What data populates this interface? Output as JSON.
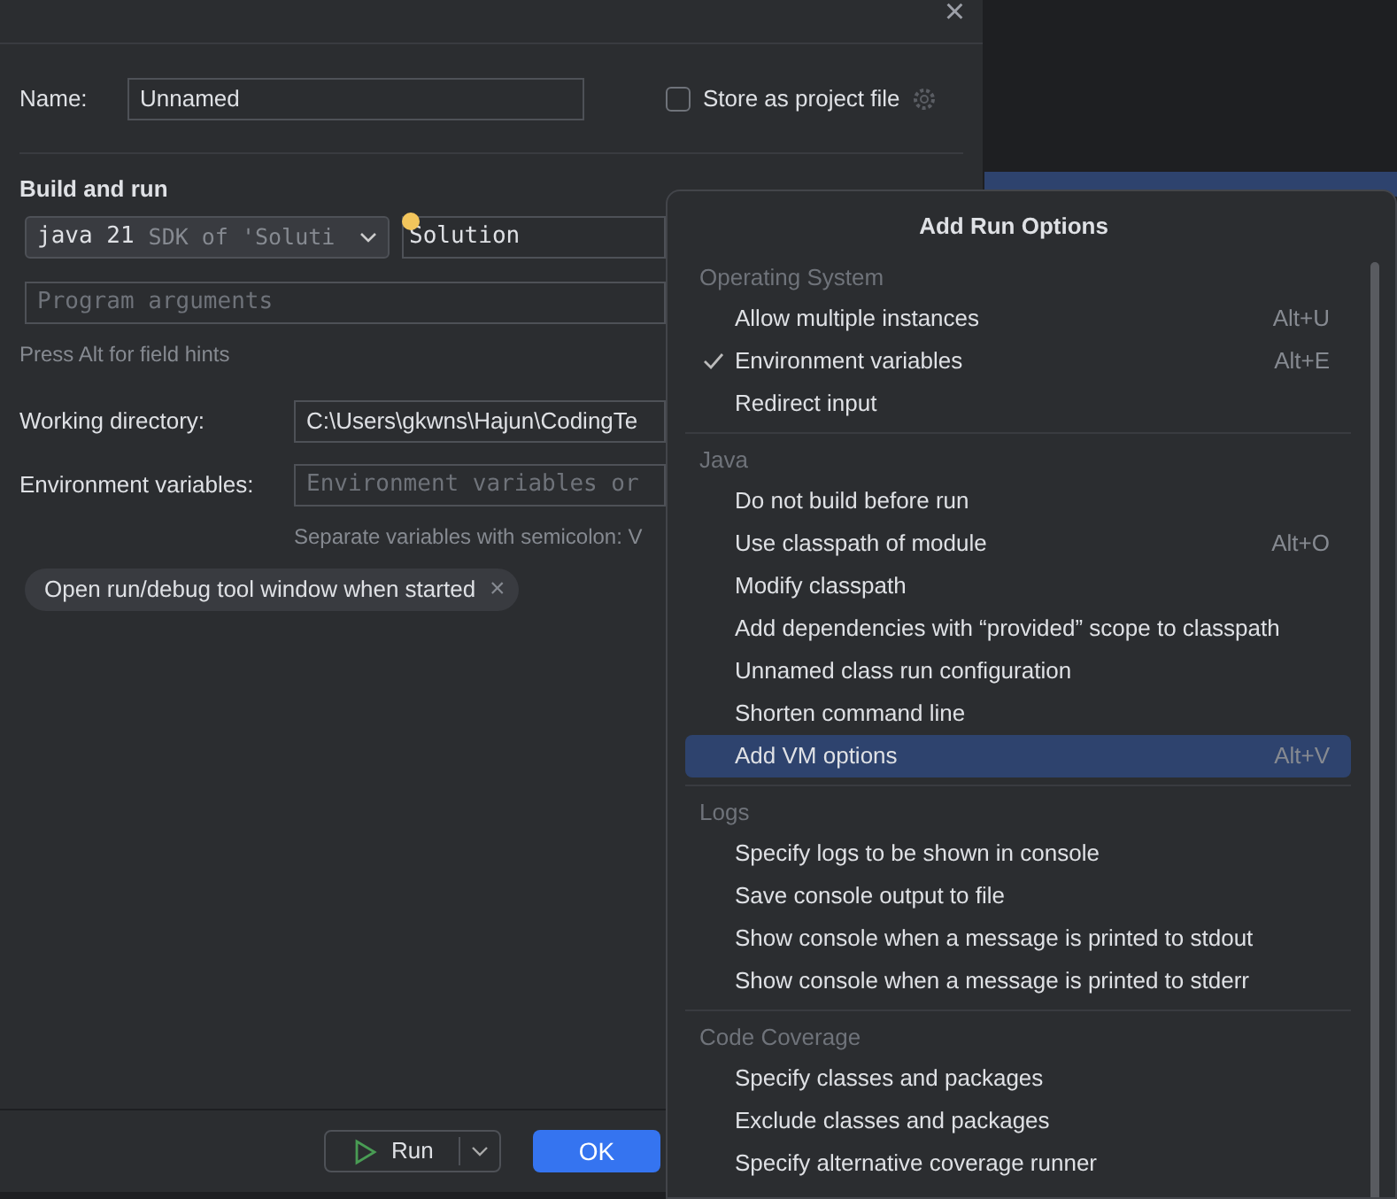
{
  "dialog": {
    "close": "×",
    "name_label": "Name:",
    "name_value": "Unnamed",
    "store_as_project_file": {
      "label": "Store as project file",
      "checked": false
    },
    "section_title": "Build and run",
    "jdk": {
      "value": "java 21",
      "hint": "SDK of 'Soluti"
    },
    "main_class": "Solution",
    "program_arguments": {
      "placeholder": "Program arguments"
    },
    "field_hint": "Press Alt for field hints",
    "working_directory": {
      "label": "Working directory:",
      "value": "C:\\Users\\gkwns\\Hajun\\CodingTe"
    },
    "environment_variables": {
      "label": "Environment variables:",
      "placeholder": "Environment variables or",
      "hint": "Separate variables with semicolon: V"
    },
    "chips": [
      {
        "label": "Open run/debug tool window when started",
        "remove": "×"
      }
    ],
    "buttons": {
      "run": "Run",
      "ok": "OK"
    }
  },
  "popup": {
    "title": "Add Run Options",
    "sections": [
      {
        "title": "Operating System",
        "items": [
          {
            "label": "Allow multiple instances",
            "shortcut": "Alt+U",
            "checked": false,
            "selected": false
          },
          {
            "label": "Environment variables",
            "shortcut": "Alt+E",
            "checked": true,
            "selected": false
          },
          {
            "label": "Redirect input",
            "checked": false,
            "selected": false
          }
        ]
      },
      {
        "title": "Java",
        "items": [
          {
            "label": "Do not build before run",
            "checked": false,
            "selected": false
          },
          {
            "label": "Use classpath of module",
            "shortcut": "Alt+O",
            "checked": false,
            "selected": false
          },
          {
            "label": "Modify classpath",
            "checked": false,
            "selected": false
          },
          {
            "label": "Add dependencies with “provided” scope to classpath",
            "checked": false,
            "selected": false
          },
          {
            "label": "Unnamed class run configuration",
            "checked": false,
            "selected": false
          },
          {
            "label": "Shorten command line",
            "checked": false,
            "selected": false
          },
          {
            "label": "Add VM options",
            "shortcut": "Alt+V",
            "checked": false,
            "selected": true
          }
        ]
      },
      {
        "title": "Logs",
        "items": [
          {
            "label": "Specify logs to be shown in console",
            "checked": false,
            "selected": false
          },
          {
            "label": "Save console output to file",
            "checked": false,
            "selected": false
          },
          {
            "label": "Show console when a message is printed to stdout",
            "checked": false,
            "selected": false
          },
          {
            "label": "Show console when a message is printed to stderr",
            "checked": false,
            "selected": false
          }
        ]
      },
      {
        "title": "Code Coverage",
        "items": [
          {
            "label": "Specify classes and packages",
            "checked": false,
            "selected": false
          },
          {
            "label": "Exclude classes and packages",
            "checked": false,
            "selected": false
          },
          {
            "label": "Specify alternative coverage runner",
            "checked": false,
            "selected": false
          }
        ]
      }
    ]
  }
}
